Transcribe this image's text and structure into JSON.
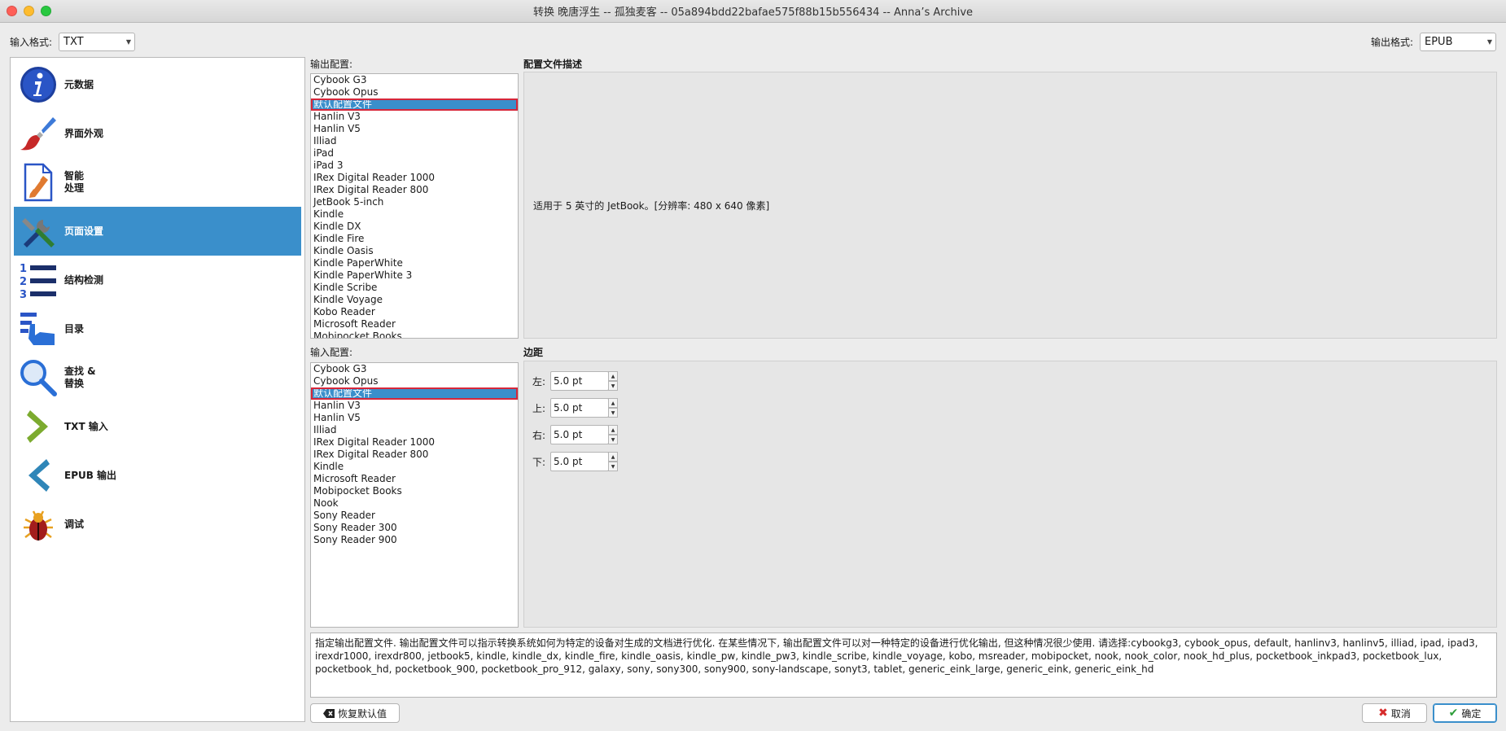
{
  "window": {
    "title": "转换 晚唐浮生 -- 孤独麦客 -- 05a894bdd22bafae575f88b15b556434 -- Anna’s Archive"
  },
  "input_format": {
    "label": "输入格式:",
    "value": "TXT"
  },
  "output_format": {
    "label": "输出格式:",
    "value": "EPUB"
  },
  "sidebar": {
    "items": [
      {
        "label": "元数据",
        "icon": "info-icon"
      },
      {
        "label": "界面外观",
        "icon": "paintbrush-icon"
      },
      {
        "label": "智能\n处理",
        "icon": "document-pencil-icon"
      },
      {
        "label": "页面设置",
        "icon": "tools-icon",
        "selected": true
      },
      {
        "label": "结构检测",
        "icon": "numbered-list-icon"
      },
      {
        "label": "目录",
        "icon": "pointing-hand-icon"
      },
      {
        "label": "查找 &\n替换",
        "icon": "magnifier-icon"
      },
      {
        "label": "TXT 输入",
        "icon": "chevron-right-icon"
      },
      {
        "label": "EPUB 输出",
        "icon": "chevron-left-icon"
      },
      {
        "label": "调试",
        "icon": "bug-icon"
      }
    ]
  },
  "output_profile": {
    "label": "输出配置:",
    "items": [
      "Cybook G3",
      "Cybook Opus",
      "默认配置文件",
      "Hanlin V3",
      "Hanlin V5",
      "Illiad",
      "iPad",
      "iPad 3",
      "IRex Digital Reader 1000",
      "IRex Digital Reader 800",
      "JetBook 5-inch",
      "Kindle",
      "Kindle DX",
      "Kindle Fire",
      "Kindle Oasis",
      "Kindle PaperWhite",
      "Kindle PaperWhite 3",
      "Kindle Scribe",
      "Kindle Voyage",
      "Kobo Reader",
      "Microsoft Reader",
      "Mobipocket Books"
    ],
    "selected": "默认配置文件"
  },
  "profile_description": {
    "label": "配置文件描述",
    "text": "适用于 5 英寸的 JetBook。[分辨率: 480 x 640 像素]"
  },
  "input_profile": {
    "label": "输入配置:",
    "items": [
      "Cybook G3",
      "Cybook Opus",
      "默认配置文件",
      "Hanlin V3",
      "Hanlin V5",
      "Illiad",
      "IRex Digital Reader 1000",
      "IRex Digital Reader 800",
      "Kindle",
      "Microsoft Reader",
      "Mobipocket Books",
      "Nook",
      "Sony Reader",
      "Sony Reader 300",
      "Sony Reader 900"
    ],
    "selected": "默认配置文件"
  },
  "margins": {
    "label": "边距",
    "left": {
      "label": "左:",
      "value": "5.0 pt"
    },
    "top": {
      "label": "上:",
      "value": "5.0 pt"
    },
    "right": {
      "label": "右:",
      "value": "5.0 pt"
    },
    "bottom": {
      "label": "下:",
      "value": "5.0 pt"
    }
  },
  "help_text": "指定输出配置文件. 输出配置文件可以指示转换系统如何为特定的设备对生成的文档进行优化. 在某些情况下, 输出配置文件可以对一种特定的设备进行优化输出, 但这种情况很少使用. 请选择:cybookg3, cybook_opus, default, hanlinv3, hanlinv5, illiad, ipad, ipad3, irexdr1000, irexdr800, jetbook5, kindle, kindle_dx, kindle_fire, kindle_oasis, kindle_pw, kindle_pw3, kindle_scribe, kindle_voyage, kobo, msreader, mobipocket, nook, nook_color, nook_hd_plus, pocketbook_inkpad3, pocketbook_lux, pocketbook_hd, pocketbook_900, pocketbook_pro_912, galaxy, sony, sony300, sony900, sony-landscape, sonyt3, tablet, generic_eink_large, generic_eink, generic_eink_hd",
  "buttons": {
    "restore_defaults": "恢复默认值",
    "cancel": "取消",
    "ok": "确定"
  },
  "colors": {
    "selection": "#3a8fcb",
    "highlight_border": "#d6273a"
  }
}
